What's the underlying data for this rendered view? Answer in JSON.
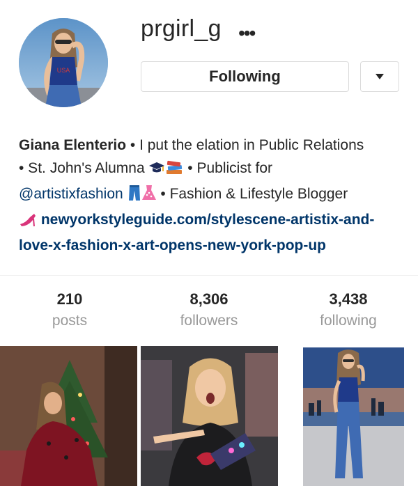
{
  "profile": {
    "username": "prgirl_g",
    "more_icon": "ellipsis-icon",
    "following_label": "Following",
    "dropdown_icon": "caret-down-icon"
  },
  "bio": {
    "name": "Giana Elenterio",
    "line1_rest": " • I put the elation in Public Relations",
    "line2": "• St. John's Alumna",
    "line2_rest": " • Publicist for",
    "mention": "@artistixfashion",
    "line3_rest": " • Fashion & Lifestyle Blogger",
    "link_line1": "newyorkstyleguide.com/stylescene-artistix-and-",
    "link_line2": "love-x-fashion-x-art-opens-new-york-pop-up",
    "emojis": [
      "graduation-cap-icon",
      "books-icon",
      "jeans-icon",
      "dress-icon",
      "high-heel-icon"
    ]
  },
  "stats": [
    {
      "value": "210",
      "label": "posts"
    },
    {
      "value": "8,306",
      "label": "followers"
    },
    {
      "value": "3,438",
      "label": "following"
    }
  ],
  "colors": {
    "text": "#262626",
    "muted": "#999999",
    "link": "#003569",
    "border": "#dbdbdb"
  }
}
